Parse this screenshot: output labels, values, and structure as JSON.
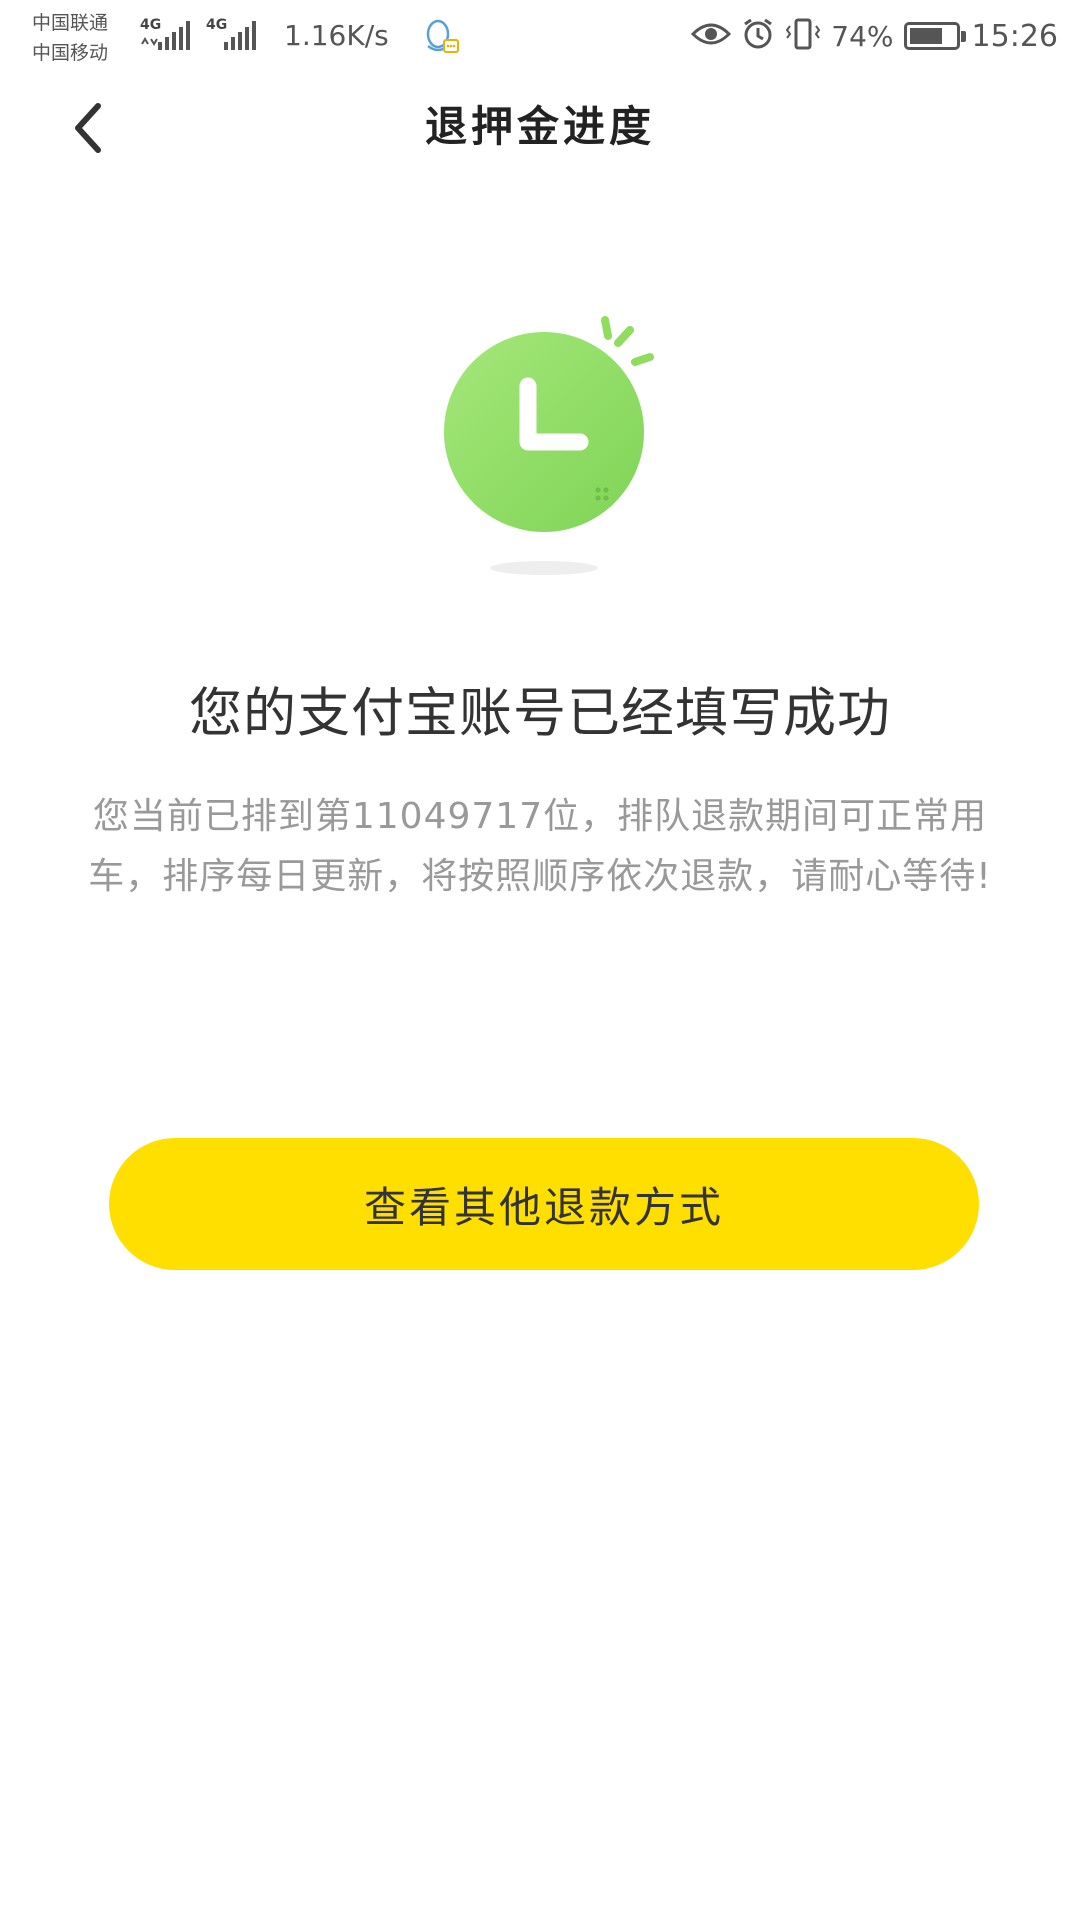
{
  "status_bar": {
    "carriers": [
      "中国联通",
      "中国移动"
    ],
    "network_type_1": "4G",
    "network_type_2": "4G",
    "net_speed": "1.16K/s",
    "battery_percent": "74%",
    "battery_level": 0.74,
    "time": "15:26",
    "icons": [
      "signal-icon",
      "qq-icon",
      "eye-icon",
      "alarm-icon",
      "vibrate-icon",
      "battery-icon"
    ]
  },
  "nav": {
    "title": "退押金进度",
    "back_icon": "chevron-left-icon"
  },
  "result": {
    "illustration": "clock-icon",
    "title": "您的支付宝账号已经填写成功",
    "description": "您当前已排到第11049717位，排队退款期间可正常用车，排序每日更新，将按照顺序依次退款，请耐心等待!"
  },
  "actions": {
    "other_methods_label": "查看其他退款方式"
  },
  "colors": {
    "accent_yellow": "#ffdf00",
    "clock_green": "#8fdc5f",
    "title_text": "#333333",
    "desc_text": "#999999"
  }
}
